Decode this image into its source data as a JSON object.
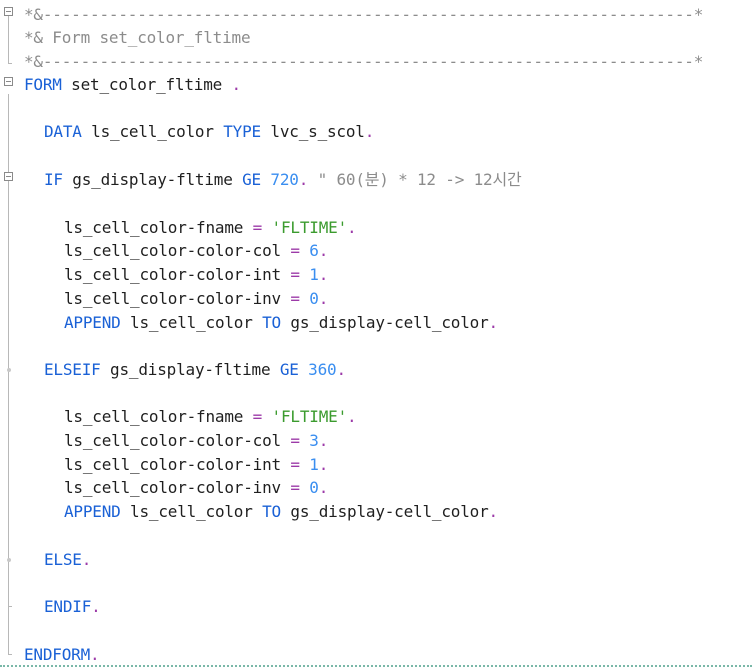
{
  "editor": {
    "lines": [
      {
        "text": "*&---------------------------------------------------------------------*",
        "type": "comment"
      },
      {
        "text": "*& Form set_color_fltime",
        "type": "comment"
      },
      {
        "text": "*&---------------------------------------------------------------------*",
        "type": "comment"
      },
      {
        "k1": "FORM",
        "i1": " set_color_fltime ",
        "o1": "."
      },
      {
        "k1": "DATA",
        "i1": " ls_cell_color ",
        "k2": "TYPE",
        "i2": " lvc_s_scol",
        "o1": "."
      },
      {
        "k1": "IF",
        "i1": " gs_display-fltime ",
        "k2": "GE",
        "n1": " 720",
        "o1": ".",
        "c1": " \" 60(분) * 12 -> 12시간"
      },
      {
        "i1": "ls_cell_color-fname ",
        "o1": "=",
        "s1": " 'FLTIME'",
        "o2": "."
      },
      {
        "i1": "ls_cell_color-color-col ",
        "o1": "=",
        "n1": " 6",
        "o2": "."
      },
      {
        "i1": "ls_cell_color-color-int ",
        "o1": "=",
        "n1": " 1",
        "o2": "."
      },
      {
        "i1": "ls_cell_color-color-inv ",
        "o1": "=",
        "n1": " 0",
        "o2": "."
      },
      {
        "k1": "APPEND",
        "i1": " ls_cell_color ",
        "k2": "TO",
        "i2": " gs_display-cell_color",
        "o1": "."
      },
      {
        "k1": "ELSEIF",
        "i1": " gs_display-fltime ",
        "k2": "GE",
        "n1": " 360",
        "o1": "."
      },
      {
        "i1": "ls_cell_color-fname ",
        "o1": "=",
        "s1": " 'FLTIME'",
        "o2": "."
      },
      {
        "i1": "ls_cell_color-color-col ",
        "o1": "=",
        "n1": " 3",
        "o2": "."
      },
      {
        "i1": "ls_cell_color-color-int ",
        "o1": "=",
        "n1": " 1",
        "o2": "."
      },
      {
        "i1": "ls_cell_color-color-inv ",
        "o1": "=",
        "n1": " 0",
        "o2": "."
      },
      {
        "k1": "APPEND",
        "i1": " ls_cell_color ",
        "k2": "TO",
        "i2": " gs_display-cell_color",
        "o1": "."
      },
      {
        "k1": "ELSE",
        "o1": "."
      },
      {
        "k1": "ENDIF",
        "o1": "."
      },
      {
        "k1": "ENDFORM",
        "o1": "."
      }
    ]
  },
  "colors": {
    "keyword": "#1a61d6",
    "comment": "#8c8c8c",
    "number": "#3a8ef0",
    "string": "#3b9b2e",
    "operator": "#9c3aa8",
    "identifier": "#1f1f1f"
  },
  "icons": {
    "fold": "fold-collapse-icon"
  }
}
